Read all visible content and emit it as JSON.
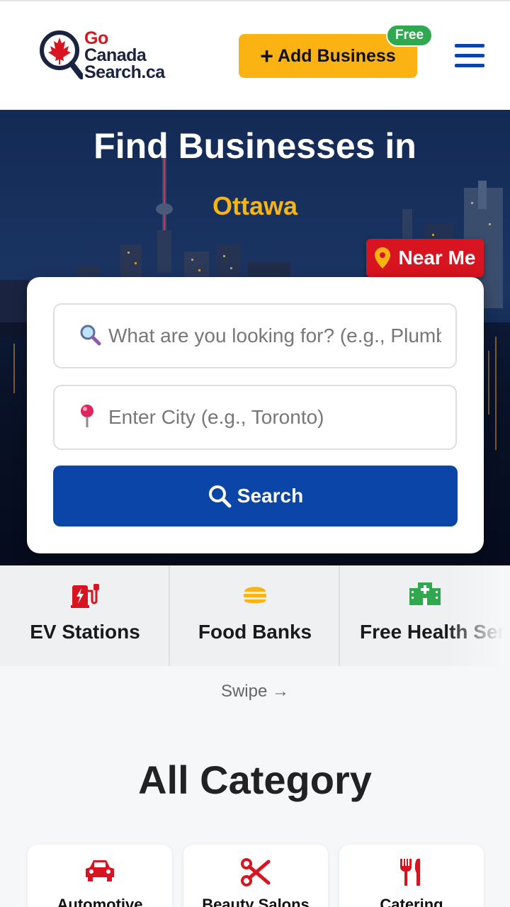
{
  "header": {
    "logo": {
      "line1": "Go",
      "line2": "Canada",
      "line3": "Search.ca"
    },
    "add_business_label": "Add Business",
    "free_badge": "Free",
    "menu_icon": "hamburger-menu-icon"
  },
  "hero": {
    "title": "Find Businesses in",
    "city": "Ottawa",
    "near_me_label": "Near Me",
    "search": {
      "what_placeholder": "What are you looking for? (e.g., Plumber)",
      "what_value": "",
      "city_placeholder": "Enter City (e.g., Toronto)",
      "city_value": "",
      "button_label": "Search"
    }
  },
  "quick_categories": {
    "items": [
      {
        "label": "EV Stations",
        "icon": "ev-charging-icon"
      },
      {
        "label": "Food Banks",
        "icon": "burger-icon"
      },
      {
        "label": "Free Health Services",
        "icon": "hospital-icon"
      }
    ],
    "swipe_hint": "Swipe →"
  },
  "all_category": {
    "title": "All Category",
    "items": [
      {
        "label": "Automotive",
        "icon": "car-icon"
      },
      {
        "label": "Beauty Salons",
        "icon": "scissors-icon"
      },
      {
        "label": "Catering",
        "icon": "utensils-icon"
      }
    ]
  },
  "colors": {
    "brand_red": "#d7141f",
    "brand_blue": "#0b45a8",
    "accent_yellow": "#fbb314",
    "free_green": "#2fa84f"
  }
}
